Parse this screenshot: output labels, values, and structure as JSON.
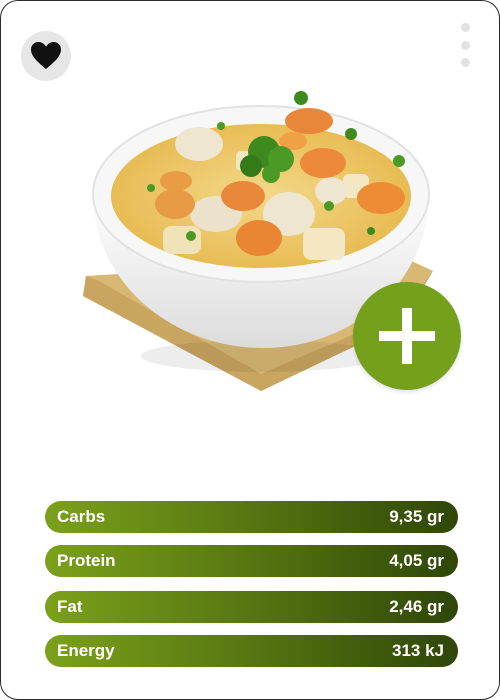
{
  "actions": {
    "favorite_icon": "heart-icon",
    "more_icon": "vertical-ellipsis-icon",
    "add_icon": "plus-icon"
  },
  "recipe": {
    "title": "",
    "subtitle": ""
  },
  "nutrition": [
    {
      "label": "Carbs",
      "value": "9,35 gr"
    },
    {
      "label": "Protein",
      "value": "4,05 gr"
    },
    {
      "label": "Fat",
      "value": "2,46 gr"
    },
    {
      "label": "Energy",
      "value": "313 kJ"
    }
  ],
  "colors": {
    "accent_green": "#74a01c",
    "bar_gradient_start": "#7ba11b",
    "bar_gradient_end": "#2f4608",
    "favorite_bg": "#e6e6e6"
  }
}
